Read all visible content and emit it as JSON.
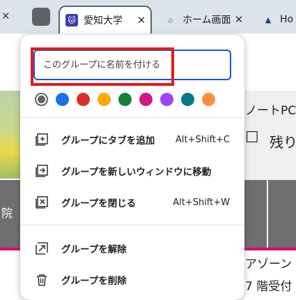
{
  "tabstrip": {
    "left_close": "✕",
    "tabs": [
      {
        "label": "愛知大学",
        "close": "✕",
        "favicon": "neko-icon"
      },
      {
        "label": "ホーム画面",
        "close": "✕",
        "favicon": "house-icon"
      },
      {
        "label": "Ho",
        "close": "",
        "favicon": "triangle-logo-icon"
      }
    ]
  },
  "background": {
    "right_title": "ノートPC",
    "right_remaining": "残り",
    "left_char": "院",
    "bottom_right_1": "アゾーン",
    "bottom_right_2": "7 階受付"
  },
  "popup": {
    "name_input": {
      "placeholder": "このグループに名前を付ける",
      "value": ""
    },
    "colors": [
      {
        "name": "grey",
        "hex": "#5f6368",
        "selected": true
      },
      {
        "name": "blue",
        "hex": "#1a73e8",
        "selected": false
      },
      {
        "name": "red",
        "hex": "#d93025",
        "selected": false
      },
      {
        "name": "yellow",
        "hex": "#f9ab00",
        "selected": false
      },
      {
        "name": "green",
        "hex": "#188038",
        "selected": false
      },
      {
        "name": "pink",
        "hex": "#d01884",
        "selected": false
      },
      {
        "name": "purple",
        "hex": "#a142f4",
        "selected": false
      },
      {
        "name": "cyan",
        "hex": "#007b83",
        "selected": false
      },
      {
        "name": "orange",
        "hex": "#fa903e",
        "selected": false
      }
    ],
    "items": [
      {
        "label": "グループにタブを追加",
        "shortcut": "Alt+Shift+C",
        "icon": "add-tab-icon"
      },
      {
        "label": "グループを新しいウィンドウに移動",
        "shortcut": "",
        "icon": "move-window-icon"
      },
      {
        "label": "グループを閉じる",
        "shortcut": "Alt+Shift+W",
        "icon": "close-group-icon"
      },
      {
        "label": "グループを解除",
        "shortcut": "",
        "icon": "ungroup-icon"
      },
      {
        "label": "グループを削除",
        "shortcut": "",
        "icon": "trash-icon"
      }
    ]
  }
}
